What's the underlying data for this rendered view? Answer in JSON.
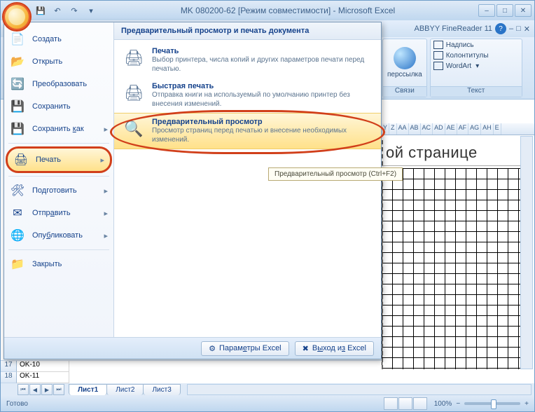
{
  "titlebar": {
    "title": "MK 080200-62  [Режим совместимости] - Microsoft Excel"
  },
  "addin": {
    "name": "ABBYY FineReader 11"
  },
  "ribbon": {
    "links_group": {
      "btn": "перссылка",
      "label": "Связи"
    },
    "text_group": {
      "item1": "Надпись",
      "item2": "Колонтитулы",
      "item3": "WordArt",
      "label": "Текст"
    }
  },
  "menu": {
    "left": {
      "create": "Создать",
      "open": "Открыть",
      "convert": "Преобразовать",
      "save": "Сохранить",
      "save_as": "Сохранить как",
      "print": "Печать",
      "prepare": "Подготовить",
      "send": "Отправить",
      "publish": "Опубликовать",
      "close": "Закрыть"
    },
    "right_head": "Предварительный просмотр и печать документа",
    "sub": {
      "print": {
        "t": "Печать",
        "d": "Выбор принтера, числа копий и других параметров печати перед печатью."
      },
      "quick": {
        "t": "Быстрая печать",
        "d": "Отправка книги на используемый по умолчанию принтер без внесения изменений."
      },
      "preview": {
        "t": "Предварительный просмотр",
        "d": "Просмотр страниц перед печатью и внесение необходимых изменений."
      }
    },
    "tooltip": "Предварительный просмотр (Ctrl+F2)",
    "footer": {
      "options": "Параметры Excel",
      "exit": "Выход из Excel"
    }
  },
  "sheet": {
    "cols": [
      "Y",
      "Z",
      "AA",
      "AB",
      "AC",
      "AD",
      "AE",
      "AF",
      "AG",
      "AH",
      "E"
    ],
    "pagetext": "ой странице",
    "rows": [
      {
        "n": "17",
        "v": "OK-10"
      },
      {
        "n": "18",
        "v": "OK-11"
      }
    ]
  },
  "tabs": {
    "t1": "Лист1",
    "t2": "Лист2",
    "t3": "Лист3"
  },
  "status": {
    "ready": "Готово",
    "zoom": "100%"
  }
}
